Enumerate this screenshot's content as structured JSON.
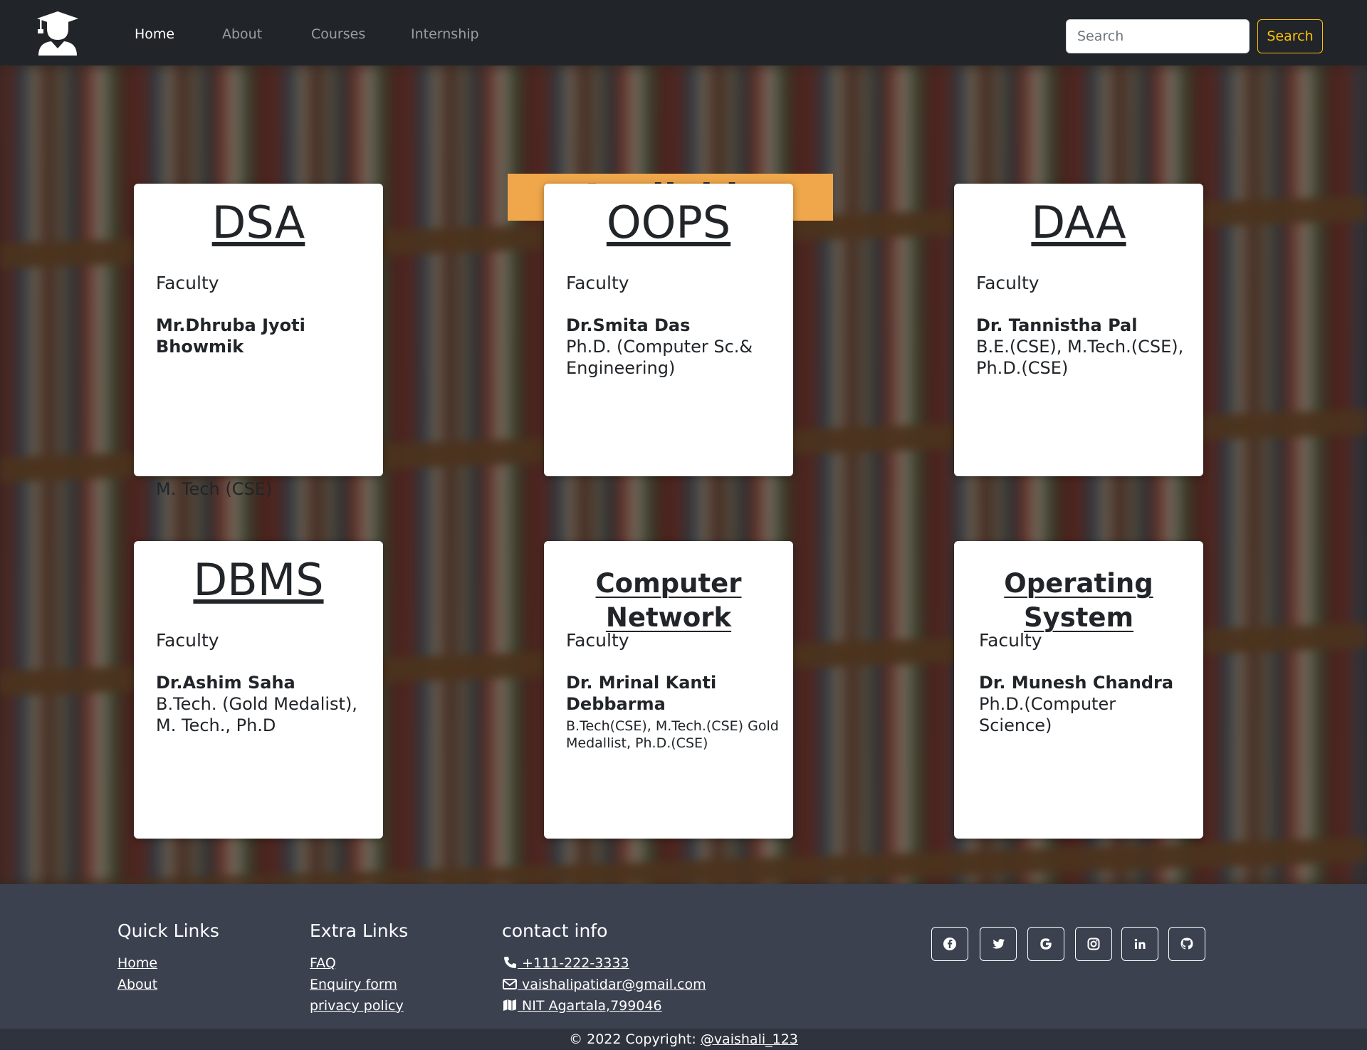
{
  "nav": {
    "logo_icon": "graduate-icon",
    "links": [
      "Home",
      "About",
      "Courses",
      "Internship"
    ],
    "active": "Home",
    "search_placeholder": "Search",
    "search_button": "Search"
  },
  "heading": "Available Courses",
  "courses": [
    {
      "title": "DSA",
      "faculty_label": "Faculty",
      "name": "Mr.Dhruba Jyoti Bhowmik",
      "qualification": "M. Tech (CSE)"
    },
    {
      "title": "OOPS",
      "faculty_label": "Faculty",
      "name": "Dr.Smita Das",
      "qualification": "Ph.D. (Computer Sc.& Engineering)"
    },
    {
      "title": "DAA",
      "faculty_label": "Faculty",
      "name": "Dr. Tannistha Pal",
      "qualification": "B.E.(CSE), M.Tech.(CSE), Ph.D.(CSE)"
    },
    {
      "title": "DBMS",
      "faculty_label": "Faculty",
      "name": "Dr.Ashim Saha",
      "qualification": "B.Tech. (Gold Medalist), M. Tech., Ph.D"
    },
    {
      "title": "Computer Network",
      "faculty_label": "Faculty",
      "name": "Dr. Mrinal Kanti Debbarma",
      "qualification": "B.Tech(CSE), M.Tech.(CSE) Gold Medallist, Ph.D.(CSE)"
    },
    {
      "title": "Operating System",
      "faculty_label": "Faculty",
      "name": "Dr. Munesh Chandra",
      "qualification": "Ph.D.(Computer Science)"
    }
  ],
  "footer": {
    "quick_links": {
      "title": "Quick Links",
      "items": [
        "Home",
        "About"
      ]
    },
    "extra_links": {
      "title": "Extra Links",
      "items": [
        "FAQ",
        "Enquiry form",
        "privacy policy"
      ]
    },
    "contact": {
      "title": "contact info",
      "phone": " +111-222-3333",
      "email": " vaishalipatidar@gmail.com",
      "address": " NIT Agartala,799046"
    },
    "social_icons": [
      "facebook-icon",
      "twitter-icon",
      "google-icon",
      "instagram-icon",
      "linkedin-icon",
      "github-icon"
    ],
    "copyright_text": "© 2022 Copyright: ",
    "copyright_handle": "@vaishali_123"
  }
}
